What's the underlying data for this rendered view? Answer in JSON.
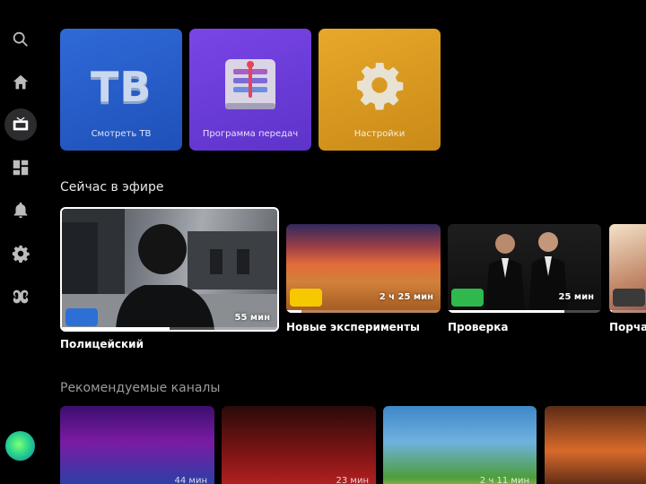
{
  "sidebar": {
    "items": [
      {
        "icon": "search-icon",
        "active": false
      },
      {
        "icon": "home-icon",
        "active": false
      },
      {
        "icon": "tv-icon",
        "active": true
      },
      {
        "icon": "apps-icon",
        "active": false
      },
      {
        "icon": "bell-icon",
        "active": false
      },
      {
        "icon": "gear-icon",
        "active": false
      },
      {
        "icon": "kids-icon",
        "active": false
      }
    ]
  },
  "tiles": {
    "tv": {
      "logo": "ТВ",
      "label": "Смотреть ТВ"
    },
    "guide": {
      "label": "Программа передач"
    },
    "settings": {
      "label": "Настройки"
    }
  },
  "now_on_air": {
    "title": "Сейчас в эфире",
    "cards": [
      {
        "title": "Полицейский",
        "duration": "55 мин",
        "progress": 0.5
      },
      {
        "title": "Новые эксперименты",
        "duration": "2 ч 25 мин",
        "progress": 0.1
      },
      {
        "title": "Проверка",
        "duration": "25 мин",
        "progress": 0.76
      },
      {
        "title": "Порча",
        "duration": "",
        "progress": 0.05
      }
    ]
  },
  "recommended": {
    "title": "Рекомендуемые каналы",
    "cards": [
      {
        "duration": "44 мин"
      },
      {
        "duration": "23 мин"
      },
      {
        "duration": "2 ч 11 мин"
      },
      {
        "duration": ""
      }
    ]
  },
  "colors": {
    "tv_tile": "#2f6ad8",
    "guide_tile": "#7a45e6",
    "settings_tile": "#e8a82a",
    "background": "#000000"
  }
}
